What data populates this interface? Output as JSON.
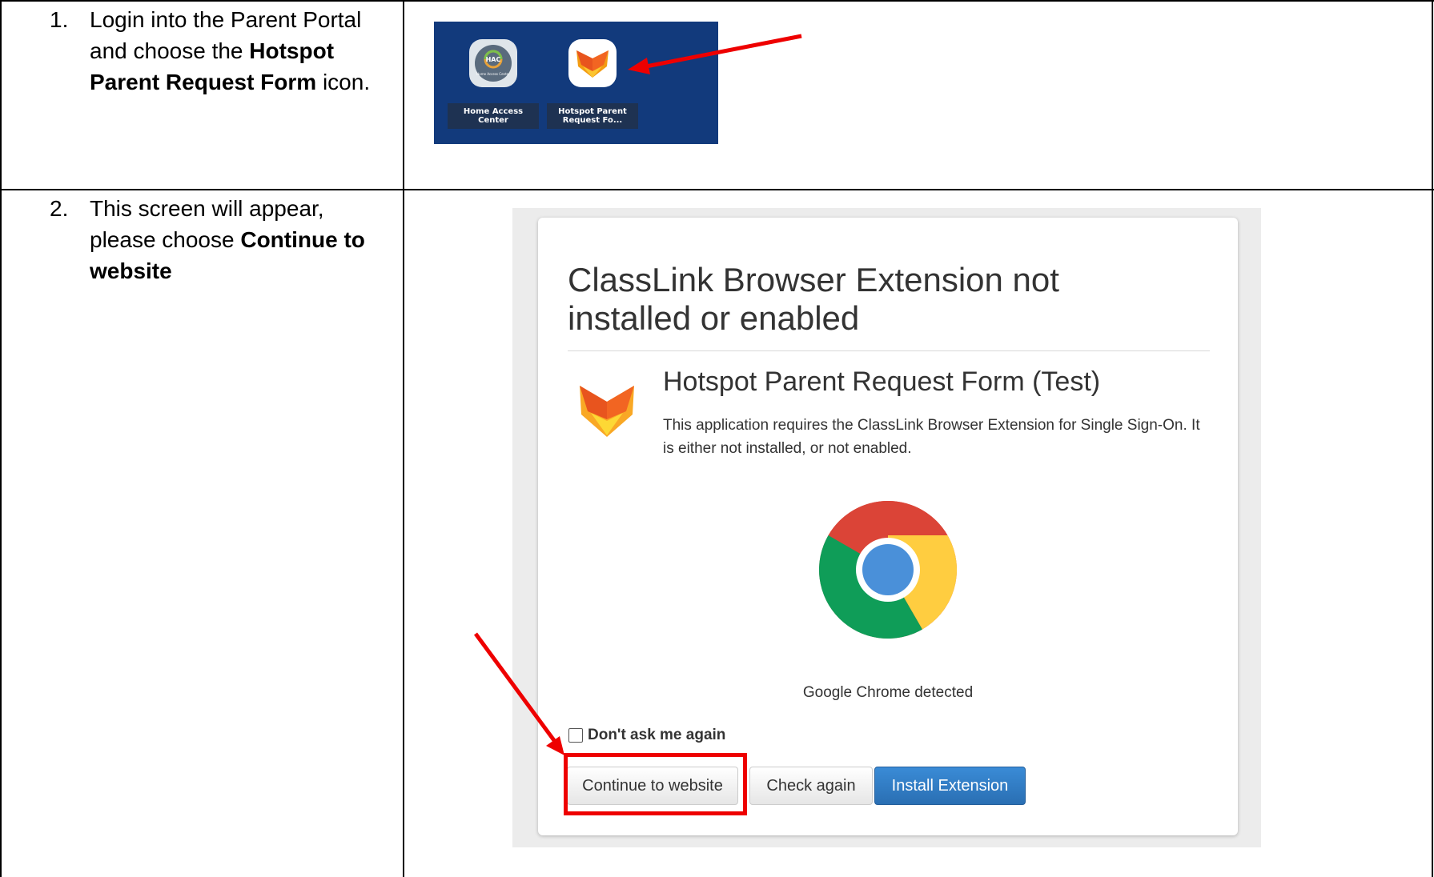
{
  "steps": [
    {
      "number": "1.",
      "parts": [
        "Login into the Parent Portal and choose the ",
        "Hotspot Parent Request Form",
        " icon."
      ]
    },
    {
      "number": "2.",
      "parts": [
        "This screen will appear, please choose ",
        "Continue to website",
        ""
      ]
    }
  ],
  "portal": {
    "apps": [
      {
        "icon_text": "HAC",
        "icon_subtext": "Home Access Center",
        "label_line1": "Home Access",
        "label_line2": "Center"
      },
      {
        "icon_name": "fox-icon",
        "label_line1": "Hotspot Parent",
        "label_line2": "Request Fo..."
      }
    ]
  },
  "dialog": {
    "title": "ClassLink Browser Extension not installed or enabled",
    "app_name": "Hotspot Parent Request Form (Test)",
    "app_description": "This application requires the ClassLink Browser Extension for Single Sign-On. It is either not installed, or not enabled.",
    "browser_detected": "Google Chrome detected",
    "checkbox_label": "Don't ask me again",
    "checkbox_checked": false,
    "buttons": {
      "continue": "Continue to website",
      "check_again": "Check again",
      "install": "Install Extension"
    }
  },
  "colors": {
    "annotation_red": "#ee0000",
    "portal_bg": "#123a7c",
    "primary_button": "#2a6fb3"
  }
}
